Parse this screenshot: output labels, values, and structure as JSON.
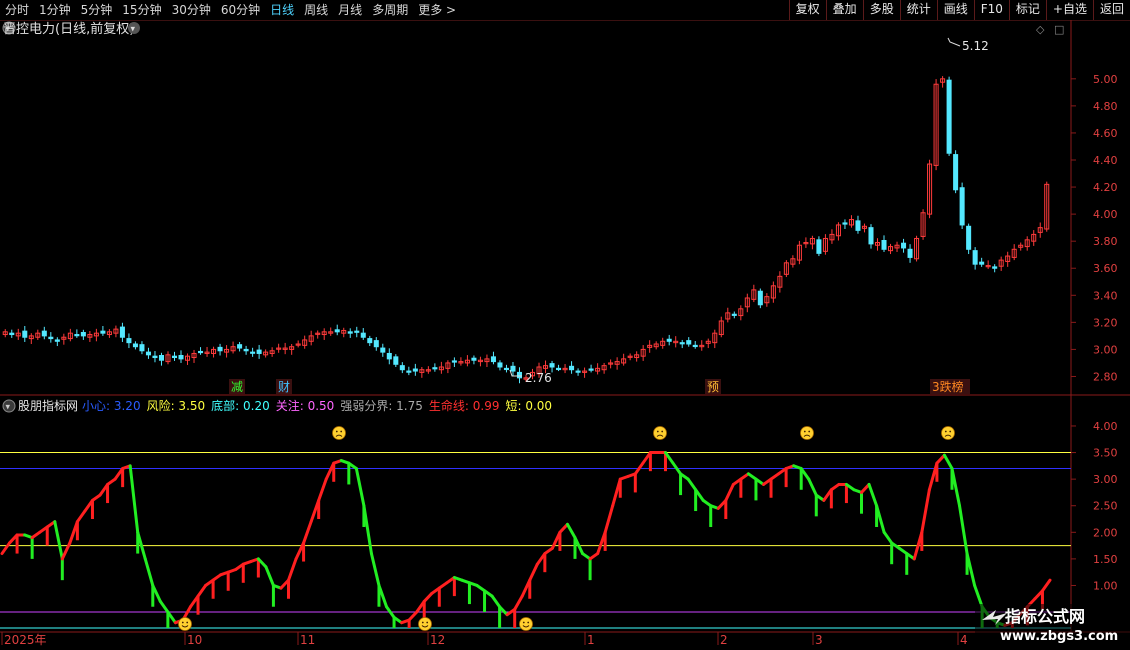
{
  "toolbar": {
    "periods": [
      "分时",
      "1分钟",
      "5分钟",
      "15分钟",
      "30分钟",
      "60分钟",
      "日线",
      "周线",
      "月线",
      "多周期",
      "更多 >"
    ],
    "active_period": "日线",
    "tools": [
      "复权",
      "叠加",
      "多股",
      "统计",
      "画线",
      "F10",
      "标记",
      "+自选",
      "返回"
    ]
  },
  "colors": {
    "up": "#ff3b3b",
    "down": "#54e8ff",
    "green_line": "#22ee22",
    "red_line": "#ff2020",
    "yellow": "#ffff40",
    "blue": "#3030ff",
    "purple": "#cc44ff",
    "cyan": "#40ffff"
  },
  "price_panel": {
    "title": "晋控电力(日线,前复权)",
    "high_label": "5.12",
    "low_label": "2.76",
    "y_ticks": [
      "5.00",
      "4.80",
      "4.60",
      "4.40",
      "4.20",
      "4.00",
      "3.80",
      "3.60",
      "3.40",
      "3.20",
      "3.00",
      "2.80"
    ],
    "markers": [
      {
        "text": "减",
        "color": "#30ff30"
      },
      {
        "text": "财",
        "color": "#40c0ff"
      },
      {
        "text": "预",
        "color": "#ffbb33"
      },
      {
        "text": "3跌榜",
        "color": "#ff8822"
      }
    ],
    "ylim": [
      2.7,
      5.25
    ]
  },
  "indicator_panel": {
    "name": "股朋指标网",
    "params": [
      {
        "label": "小心:",
        "value": "3.20",
        "color": "#2a5cff"
      },
      {
        "label": "风险:",
        "value": "3.50",
        "color": "#ffff40"
      },
      {
        "label": "底部:",
        "value": "0.20",
        "color": "#40ffff"
      },
      {
        "label": "关注:",
        "value": "0.50",
        "color": "#ff66ff"
      },
      {
        "label": "强弱分界:",
        "value": "1.75",
        "color": "#aaaaaa"
      },
      {
        "label": "生命线:",
        "value": "0.99",
        "color": "#ff3030"
      },
      {
        "label": "短:",
        "value": "0.00",
        "color": "#ffff40"
      }
    ],
    "y_ticks": [
      "4.00",
      "3.50",
      "3.00",
      "2.50",
      "2.00",
      "1.50",
      "1.00"
    ],
    "levels": [
      3.5,
      3.2,
      1.75,
      0.5,
      0.2
    ],
    "ylim": [
      0.2,
      4.15
    ]
  },
  "x_axis": {
    "labels": [
      "2025年",
      "10",
      "11",
      "12",
      "1",
      "2",
      "3",
      "4"
    ]
  },
  "chart_data": {
    "type": "line",
    "price_closes": [
      3.13,
      3.11,
      3.12,
      3.09,
      3.1,
      3.12,
      3.1,
      3.08,
      3.06,
      3.09,
      3.12,
      3.11,
      3.1,
      3.11,
      3.12,
      3.12,
      3.13,
      3.15,
      3.09,
      3.05,
      3.02,
      2.99,
      2.96,
      2.94,
      2.92,
      2.96,
      2.94,
      2.93,
      2.95,
      2.97,
      2.98,
      2.98,
      3.0,
      2.99,
      3.0,
      3.02,
      3.01,
      2.99,
      2.98,
      2.97,
      2.98,
      2.99,
      3.01,
      3.01,
      3.02,
      3.04,
      3.07,
      3.1,
      3.12,
      3.13,
      3.13,
      3.13,
      3.14,
      3.12,
      3.13,
      3.09,
      3.05,
      3.02,
      2.98,
      2.93,
      2.89,
      2.85,
      2.84,
      2.84,
      2.85,
      2.85,
      2.86,
      2.87,
      2.9,
      2.91,
      2.91,
      2.92,
      2.92,
      2.92,
      2.93,
      2.91,
      2.87,
      2.86,
      2.84,
      2.79,
      2.79,
      2.83,
      2.87,
      2.88,
      2.87,
      2.86,
      2.86,
      2.85,
      2.84,
      2.84,
      2.85,
      2.86,
      2.88,
      2.9,
      2.91,
      2.93,
      2.95,
      2.96,
      3.0,
      3.03,
      3.04,
      3.06,
      3.06,
      3.06,
      3.05,
      3.04,
      3.03,
      3.03,
      3.06,
      3.12,
      3.21,
      3.27,
      3.26,
      3.3,
      3.38,
      3.44,
      3.33,
      3.39,
      3.47,
      3.54,
      3.64,
      3.67,
      3.77,
      3.79,
      3.82,
      3.71,
      3.82,
      3.85,
      3.92,
      3.93,
      3.96,
      3.88,
      3.91,
      3.78,
      3.79,
      3.74,
      3.76,
      3.77,
      3.75,
      3.68,
      3.82,
      4.01,
      4.37,
      4.96,
      5.0,
      4.45,
      4.18,
      3.92,
      3.74,
      3.63,
      3.63,
      3.62,
      3.6,
      3.66,
      3.69,
      3.74,
      3.77,
      3.81,
      3.85,
      3.9,
      4.22
    ],
    "indicator_values": [
      1.6,
      1.8,
      1.95,
      1.95,
      1.9,
      2.0,
      2.1,
      2.2,
      1.5,
      1.8,
      2.2,
      2.4,
      2.6,
      2.7,
      2.9,
      3.0,
      3.2,
      3.25,
      2.0,
      1.5,
      1.0,
      0.7,
      0.5,
      0.3,
      0.35,
      0.6,
      0.8,
      1.0,
      1.1,
      1.2,
      1.25,
      1.3,
      1.4,
      1.45,
      1.5,
      1.35,
      1.0,
      0.95,
      1.1,
      1.5,
      1.8,
      2.2,
      2.6,
      3.0,
      3.3,
      3.35,
      3.3,
      3.2,
      2.5,
      1.6,
      1.0,
      0.6,
      0.4,
      0.3,
      0.35,
      0.5,
      0.7,
      0.85,
      0.95,
      1.05,
      1.15,
      1.1,
      1.05,
      1.0,
      0.9,
      0.8,
      0.6,
      0.45,
      0.55,
      0.8,
      1.1,
      1.4,
      1.6,
      1.7,
      2.0,
      2.15,
      1.9,
      1.6,
      1.5,
      1.6,
      2.0,
      2.5,
      3.0,
      3.05,
      3.1,
      3.3,
      3.5,
      3.5,
      3.5,
      3.3,
      3.1,
      3.0,
      2.8,
      2.6,
      2.5,
      2.45,
      2.6,
      2.9,
      3.0,
      3.1,
      3.0,
      2.9,
      3.0,
      3.1,
      3.2,
      3.25,
      3.2,
      3.0,
      2.7,
      2.6,
      2.8,
      2.9,
      2.9,
      2.8,
      2.75,
      2.9,
      2.5,
      2.0,
      1.8,
      1.7,
      1.6,
      1.5,
      2.0,
      2.8,
      3.3,
      3.45,
      3.2,
      2.5,
      1.6,
      1.0,
      0.6,
      0.4,
      0.3,
      0.25,
      0.3,
      0.45,
      0.6,
      0.75,
      0.9,
      1.1
    ],
    "xlabel": "",
    "ylabel": ""
  }
}
